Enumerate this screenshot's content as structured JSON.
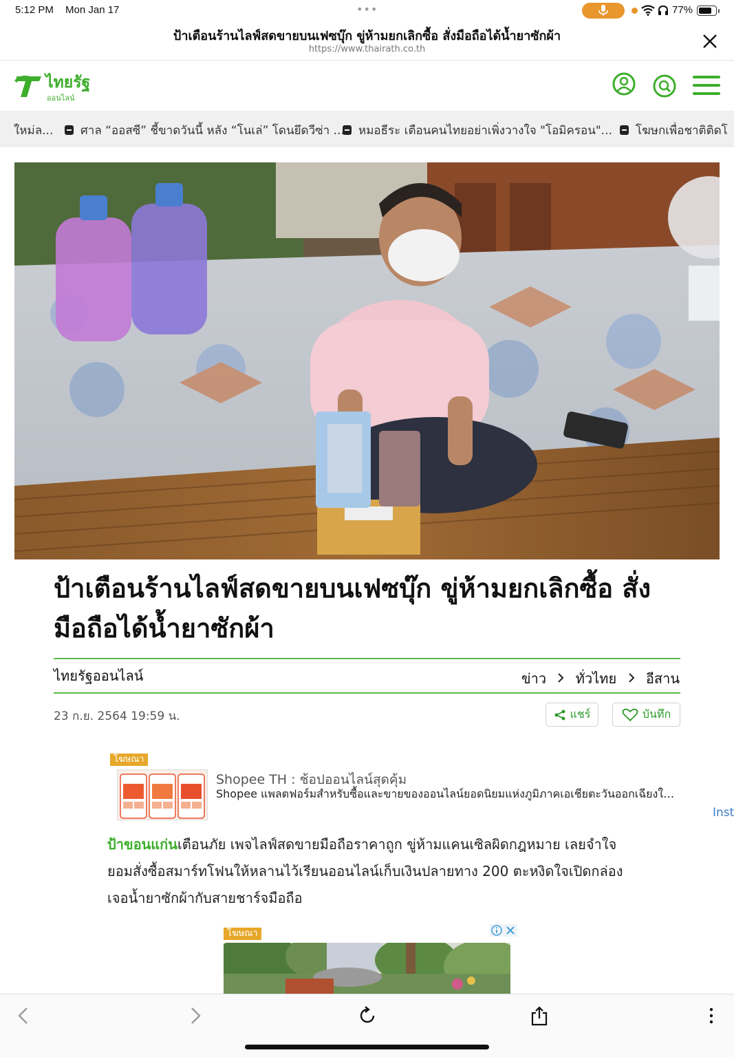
{
  "status_bar": {
    "time": "5:12 PM",
    "date": "Mon Jan 17",
    "battery": "77%",
    "battery_level": 0.77
  },
  "browser": {
    "page_title": "ป้าเตือนร้านไลฟ์สดขายบนเฟซบุ๊ก ขู่ห้ามยกเลิกซื้อ สั่งมือถือได้น้ำยาซักผ้า",
    "url": "https://www.thairath.co.th"
  },
  "site": {
    "logo_name": "ไทยรัฐ",
    "logo_sub": "ออนไลน์",
    "brand_color": "#3dae2b",
    "icons": [
      "user-icon",
      "search-icon",
      "menu-icon"
    ]
  },
  "ticker": {
    "items": [
      "ใหม่ล...",
      "ศาล “ออสซี” ชี้ขาดวันนี้ หลัง “โนเล่” โดนยึดวีซ่า ...",
      "หมอธีระ เตือนคนไทยอย่าเพิ่งวางใจ \"โอมิครอน\"...",
      "โฆษกเพื่อชาติติดโ"
    ]
  },
  "article": {
    "headline": "ป้าเตือนร้านไลฟ์สดขายบนเฟซบุ๊ก ขู่ห้ามยกเลิกซื้อ สั่งมือถือได้น้ำยาซักผ้า",
    "source": "ไทยรัฐออนไลน์",
    "breadcrumbs": [
      "ข่าว",
      "ทั่วไทย",
      "อีสาน"
    ],
    "date": "23 ก.ย. 2564 19:59 น.",
    "share_label": "แชร์",
    "save_label": "บันทึก",
    "location": "ป้าขอนแก่น",
    "body": "เตือนภัย เพจไลฟ์สดขายมือถือราคาถูก ขู่ห้ามแคนเซิลผิดกฎหมาย เลยจำใจยอมสั่งซื้อสมาร์ทโฟนให้หลานไว้เรียนออนไลน์เก็บเงินปลายทาง 200 ตะหงิดใจเปิดกล่องเจอน้ำยาซักผ้ากับสายชาร์จมือถือ"
  },
  "ads": {
    "label": "โฆษณา",
    "ad1_title": "Shopee TH : ช้อปออนไลน์สุดคุ้ม",
    "ad1_desc": "Shopee แพลตฟอร์มสำหรับซื้อและขายของออนไลน์ยอดนิยมแห่งภูมิภาคเอเชียตะวันออกเฉียงใต้และไต...",
    "side_text": "Inst"
  },
  "toolbar": {
    "icons": [
      "back-icon",
      "forward-icon",
      "reload-icon",
      "share-icon",
      "more-icon"
    ]
  }
}
